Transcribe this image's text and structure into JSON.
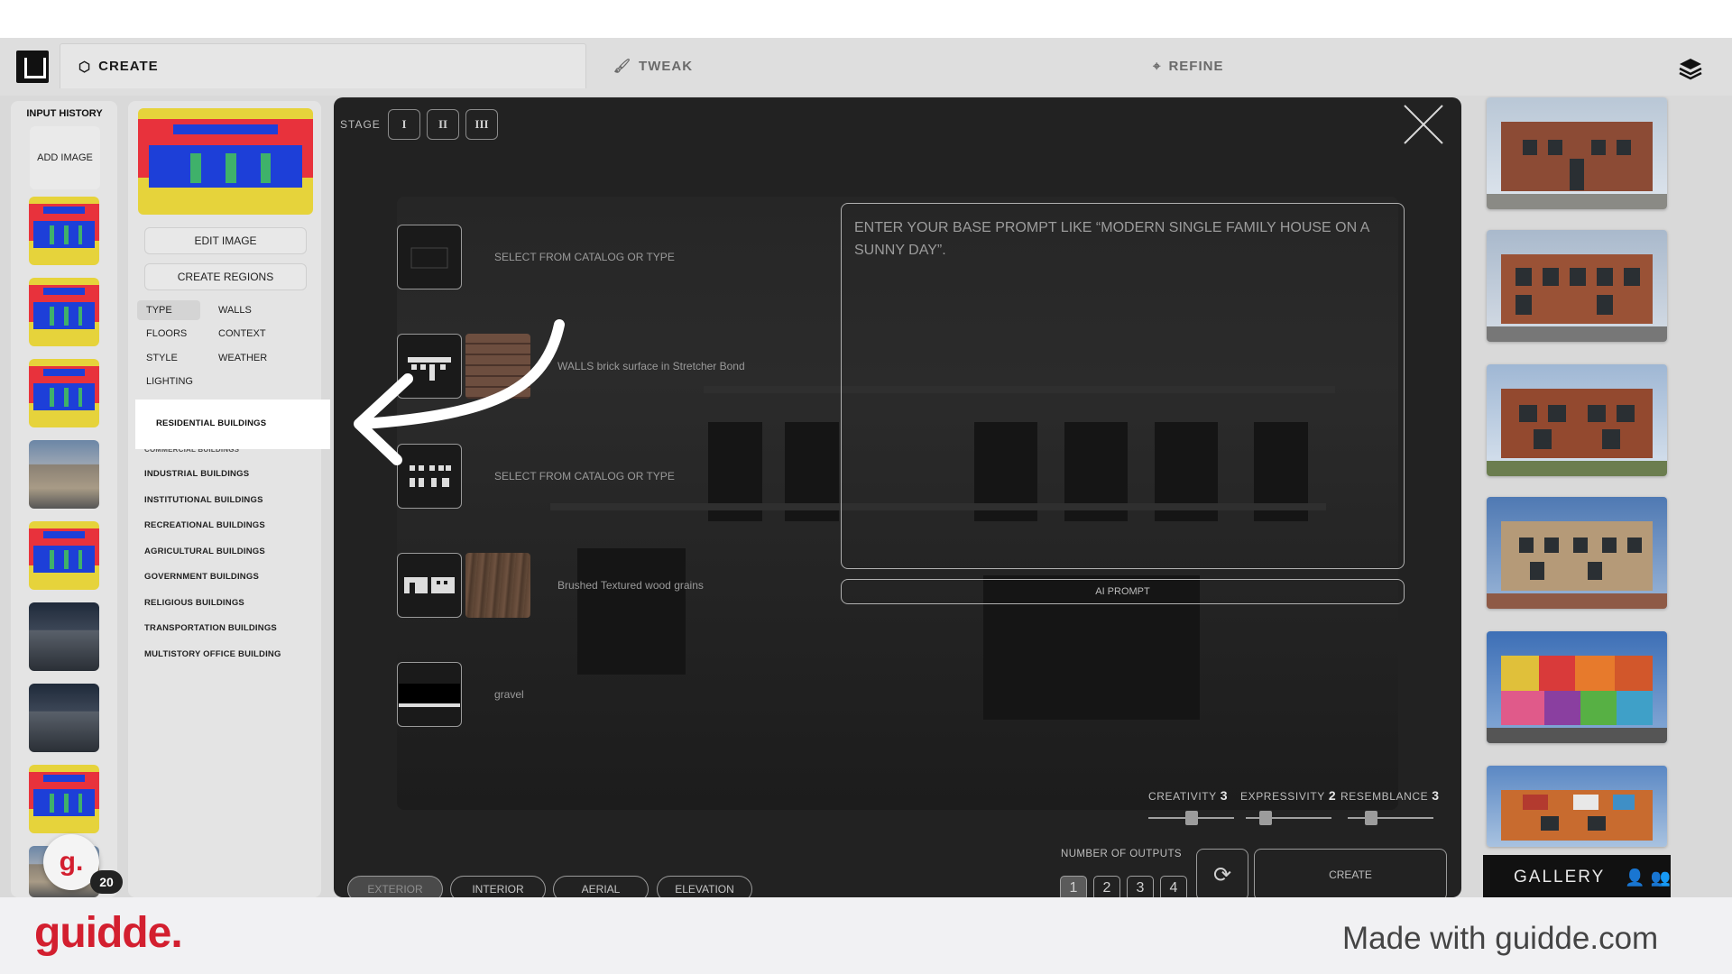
{
  "tabs": {
    "create": "CREATE",
    "tweak": "TWEAK",
    "refine": "REFINE"
  },
  "history": {
    "title": "INPUT HISTORY",
    "add_image": "ADD IMAGE",
    "badge_count": "20",
    "avatar_letter": "g."
  },
  "left_panel": {
    "edit_image": "EDIT IMAGE",
    "create_regions": "CREATE REGIONS",
    "options": [
      "TYPE",
      "WALLS",
      "FLOORS",
      "CONTEXT",
      "STYLE",
      "WEATHER",
      "LIGHTING"
    ],
    "categories": [
      "RESIDENTIAL BUILDINGS",
      "COMMERCIAL BUILDINGS",
      "INDUSTRIAL BUILDINGS",
      "INSTITUTIONAL BUILDINGS",
      "RECREATIONAL BUILDINGS",
      "AGRICULTURAL BUILDINGS",
      "GOVERNMENT BUILDINGS",
      "RELIGIOUS BUILDINGS",
      "TRANSPORTATION BUILDINGS",
      "MULTISTORY OFFICE BUILDING"
    ]
  },
  "stage": {
    "label": "STAGE",
    "buttons": [
      "I",
      "II",
      "III"
    ]
  },
  "materials": [
    {
      "label": "SELECT FROM CATALOG OR TYPE"
    },
    {
      "label": "WALLS brick surface in Stretcher Bond"
    },
    {
      "label": "SELECT FROM CATALOG OR TYPE"
    },
    {
      "label": "Brushed Textured wood grains"
    },
    {
      "label": "gravel"
    }
  ],
  "prompt": {
    "placeholder": "ENTER YOUR BASE PROMPT LIKE “MODERN SINGLE FAMILY HOUSE ON A SUNNY DAY”.",
    "ai_button": "AI PROMPT"
  },
  "sliders": [
    {
      "label": "CREATIVITY",
      "value": "3"
    },
    {
      "label": "EXPRESSIVITY",
      "value": "2"
    },
    {
      "label": "RESEMBLANCE",
      "value": "3"
    }
  ],
  "outputs": {
    "label": "NUMBER OF OUTPUTS",
    "options": [
      "1",
      "2",
      "3",
      "4"
    ],
    "selected": "1"
  },
  "create_button": "CREATE",
  "views": [
    "EXTERIOR",
    "INTERIOR",
    "AERIAL",
    "ELEVATION"
  ],
  "gallery_button": "GALLERY",
  "footer": {
    "brand": "guidde.",
    "made_with": "Made with guidde.com"
  },
  "colors": {
    "brand_red": "#d31f2f",
    "dark_panel": "#222222",
    "highlight": "#ffffff"
  }
}
